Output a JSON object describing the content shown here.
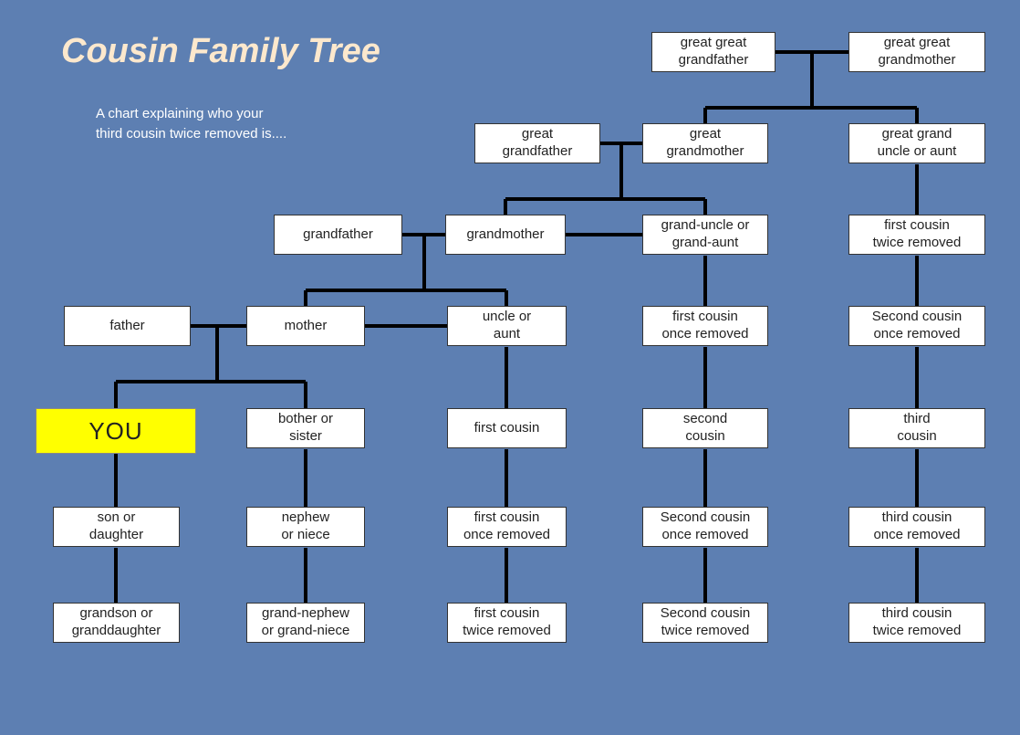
{
  "title": "Cousin Family Tree",
  "subtitle_line1": "A chart explaining who your",
  "subtitle_line2": "third cousin twice removed is....",
  "nodes": {
    "ggfather": "great great\ngrandfather",
    "ggmother": "great great\ngrandmother",
    "gfather2": "great\ngrandfather",
    "gmother2": "great\ngrandmother",
    "gguncle": "great grand\nuncle or aunt",
    "grandfather": "grandfather",
    "grandmother": "grandmother",
    "granduncle": "grand-uncle or\ngrand-aunt",
    "fc2r_a": "first cousin\ntwice removed",
    "father": "father",
    "mother": "mother",
    "uncle": "uncle or\naunt",
    "fc1r_a": "first cousin\nonce removed",
    "sc1r_a": "Second cousin\nonce removed",
    "you": "YOU",
    "sibling": "bother or\nsister",
    "firstcousin": "first cousin",
    "secondcousin": "second\ncousin",
    "thirdcousin": "third\ncousin",
    "son": "son or\ndaughter",
    "nephew": "nephew\nor niece",
    "fc1r_b": "first cousin\nonce removed",
    "sc1r_b": "Second cousin\nonce removed",
    "tc1r": "third cousin\nonce removed",
    "grandson": "grandson or\ngranddaughter",
    "grandnephew": "grand-nephew\nor grand-niece",
    "fc2r_b": "first cousin\ntwice removed",
    "sc2r": "Second cousin\ntwice removed",
    "tc2r": "third cousin\ntwice removed"
  },
  "chart_data": {
    "type": "tree",
    "title": "Cousin Family Tree",
    "description": "A chart explaining who your third cousin twice removed is....",
    "nodes": [
      {
        "id": "ggfather",
        "label": "great great grandfather",
        "gen": 0
      },
      {
        "id": "ggmother",
        "label": "great great grandmother",
        "gen": 0
      },
      {
        "id": "gfather2",
        "label": "great grandfather",
        "gen": 1
      },
      {
        "id": "gmother2",
        "label": "great grandmother",
        "gen": 1
      },
      {
        "id": "gguncle",
        "label": "great grand uncle or aunt",
        "gen": 1
      },
      {
        "id": "grandfather",
        "label": "grandfather",
        "gen": 2
      },
      {
        "id": "grandmother",
        "label": "grandmother",
        "gen": 2
      },
      {
        "id": "granduncle",
        "label": "grand-uncle or grand-aunt",
        "gen": 2
      },
      {
        "id": "fc2r_a",
        "label": "first cousin twice removed",
        "gen": 2
      },
      {
        "id": "father",
        "label": "father",
        "gen": 3
      },
      {
        "id": "mother",
        "label": "mother",
        "gen": 3
      },
      {
        "id": "uncle",
        "label": "uncle or aunt",
        "gen": 3
      },
      {
        "id": "fc1r_a",
        "label": "first cousin once removed",
        "gen": 3
      },
      {
        "id": "sc1r_a",
        "label": "Second cousin once removed",
        "gen": 3
      },
      {
        "id": "you",
        "label": "YOU",
        "gen": 4,
        "highlight": true
      },
      {
        "id": "sibling",
        "label": "bother or sister",
        "gen": 4
      },
      {
        "id": "firstcousin",
        "label": "first cousin",
        "gen": 4
      },
      {
        "id": "secondcousin",
        "label": "second cousin",
        "gen": 4
      },
      {
        "id": "thirdcousin",
        "label": "third cousin",
        "gen": 4
      },
      {
        "id": "son",
        "label": "son or daughter",
        "gen": 5
      },
      {
        "id": "nephew",
        "label": "nephew or niece",
        "gen": 5
      },
      {
        "id": "fc1r_b",
        "label": "first cousin once removed",
        "gen": 5
      },
      {
        "id": "sc1r_b",
        "label": "Second cousin once removed",
        "gen": 5
      },
      {
        "id": "tc1r",
        "label": "third cousin once removed",
        "gen": 5
      },
      {
        "id": "grandson",
        "label": "grandson or granddaughter",
        "gen": 6
      },
      {
        "id": "grandnephew",
        "label": "grand-nephew or grand-niece",
        "gen": 6
      },
      {
        "id": "fc2r_b",
        "label": "first cousin twice removed",
        "gen": 6
      },
      {
        "id": "sc2r",
        "label": "Second cousin twice removed",
        "gen": 6
      },
      {
        "id": "tc2r",
        "label": "third cousin twice removed",
        "gen": 6
      }
    ],
    "couples": [
      [
        "ggfather",
        "ggmother"
      ],
      [
        "gfather2",
        "gmother2"
      ],
      [
        "grandfather",
        "grandmother"
      ],
      [
        "father",
        "mother"
      ]
    ],
    "children": [
      {
        "parents_couple": [
          "ggfather",
          "ggmother"
        ],
        "children": [
          "gmother2",
          "gguncle"
        ]
      },
      {
        "parents_couple": [
          "gfather2",
          "gmother2"
        ],
        "children": [
          "grandmother",
          "granduncle"
        ]
      },
      {
        "parents_couple": [
          "grandfather",
          "grandmother"
        ],
        "children": [
          "mother",
          "uncle"
        ]
      },
      {
        "parents_couple": [
          "father",
          "mother"
        ],
        "children": [
          "you",
          "sibling"
        ]
      },
      {
        "parent": "gguncle",
        "children": [
          "fc2r_a"
        ]
      },
      {
        "parent": "granduncle",
        "children": [
          "fc1r_a"
        ]
      },
      {
        "parent": "fc2r_a",
        "children": [
          "sc1r_a"
        ]
      },
      {
        "parent": "uncle",
        "children": [
          "firstcousin"
        ]
      },
      {
        "parent": "fc1r_a",
        "children": [
          "secondcousin"
        ]
      },
      {
        "parent": "sc1r_a",
        "children": [
          "thirdcousin"
        ]
      },
      {
        "parent": "you",
        "children": [
          "son"
        ]
      },
      {
        "parent": "sibling",
        "children": [
          "nephew"
        ]
      },
      {
        "parent": "firstcousin",
        "children": [
          "fc1r_b"
        ]
      },
      {
        "parent": "secondcousin",
        "children": [
          "sc1r_b"
        ]
      },
      {
        "parent": "thirdcousin",
        "children": [
          "tc1r"
        ]
      },
      {
        "parent": "son",
        "children": [
          "grandson"
        ]
      },
      {
        "parent": "nephew",
        "children": [
          "grandnephew"
        ]
      },
      {
        "parent": "fc1r_b",
        "children": [
          "fc2r_b"
        ]
      },
      {
        "parent": "sc1r_b",
        "children": [
          "sc2r"
        ]
      },
      {
        "parent": "tc1r",
        "children": [
          "tc2r"
        ]
      }
    ]
  }
}
